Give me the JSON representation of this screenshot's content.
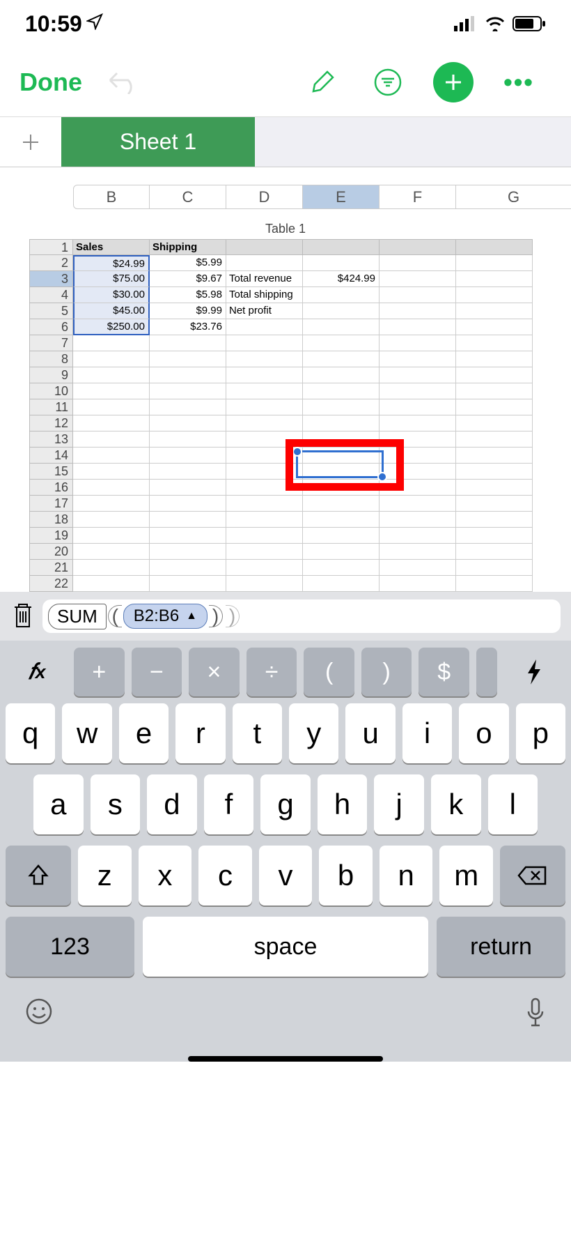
{
  "status": {
    "time": "10:59"
  },
  "toolbar": {
    "done": "Done"
  },
  "sheets": {
    "active": "Sheet 1"
  },
  "columns": [
    "B",
    "C",
    "D",
    "E",
    "F",
    "G"
  ],
  "selected_column": "E",
  "table_title": "Table 1",
  "rows": [
    "1",
    "2",
    "3",
    "4",
    "5",
    "6",
    "7",
    "8",
    "9",
    "10",
    "11",
    "12",
    "13",
    "14",
    "15",
    "16",
    "17",
    "18",
    "19",
    "20",
    "21",
    "22"
  ],
  "headers": {
    "B": "Sales",
    "C": "Shipping"
  },
  "cells": {
    "B2": "$24.99",
    "B3": "$75.00",
    "B4": "$30.00",
    "B5": "$45.00",
    "B6": "$250.00",
    "C2": "$5.99",
    "C3": "$9.67",
    "C4": "$5.98",
    "C5": "$9.99",
    "C6": "$23.76",
    "D3": "Total  revenue",
    "D4": "Total shipping",
    "D5": "Net profit",
    "E3": "$424.99"
  },
  "formula": {
    "fn": "SUM",
    "range": "B2:B6"
  },
  "keyboard": {
    "ops": [
      "+",
      "−",
      "×",
      "÷",
      "(",
      ")",
      "$"
    ],
    "row1": [
      "q",
      "w",
      "e",
      "r",
      "t",
      "y",
      "u",
      "i",
      "o",
      "p"
    ],
    "row2": [
      "a",
      "s",
      "d",
      "f",
      "g",
      "h",
      "j",
      "k",
      "l"
    ],
    "row3": [
      "z",
      "x",
      "c",
      "v",
      "b",
      "n",
      "m"
    ],
    "num": "123",
    "space": "space",
    "ret": "return"
  }
}
